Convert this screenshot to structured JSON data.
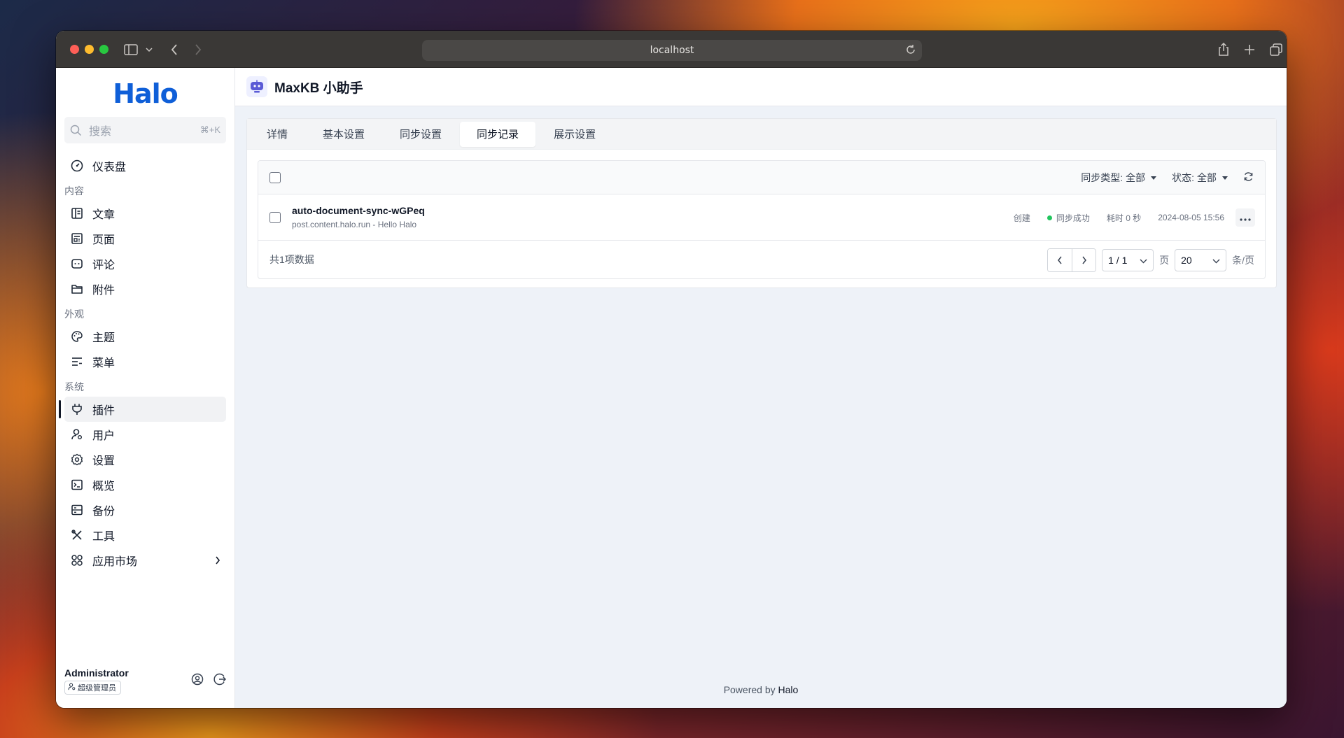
{
  "browser": {
    "url": "localhost"
  },
  "sidebar": {
    "logo": "Halo",
    "search": {
      "placeholder": "搜索",
      "shortcut": "⌘+K"
    },
    "dashboard": "仪表盘",
    "groups": [
      {
        "label": "内容",
        "items": [
          "文章",
          "页面",
          "评论",
          "附件"
        ]
      },
      {
        "label": "外观",
        "items": [
          "主题",
          "菜单"
        ]
      },
      {
        "label": "系统",
        "items": [
          "插件",
          "用户",
          "设置",
          "概览",
          "备份",
          "工具",
          "应用市场"
        ]
      }
    ],
    "active_item": "插件",
    "user": {
      "name": "Administrator",
      "role": "超级管理员"
    }
  },
  "page": {
    "title": "MaxKB 小助手",
    "tabs": [
      "详情",
      "基本设置",
      "同步设置",
      "同步记录",
      "展示设置"
    ],
    "active_tab": "同步记录"
  },
  "filters": {
    "sync_type_label": "同步类型:",
    "sync_type_value": "全部",
    "status_label": "状态:",
    "status_value": "全部"
  },
  "records": [
    {
      "title": "auto-document-sync-wGPeq",
      "subtitle": "post.content.halo.run - Hello Halo",
      "action": "创建",
      "status": "同步成功",
      "duration": "耗时 0 秒",
      "time": "2024-08-05 15:56",
      "status_color": "#22c55e"
    }
  ],
  "pagination": {
    "total": "共1项数据",
    "page": "1 / 1",
    "page_unit": "页",
    "size": "20",
    "size_unit": "条/页"
  },
  "footer": {
    "prefix": "Powered by",
    "brand": "Halo"
  }
}
